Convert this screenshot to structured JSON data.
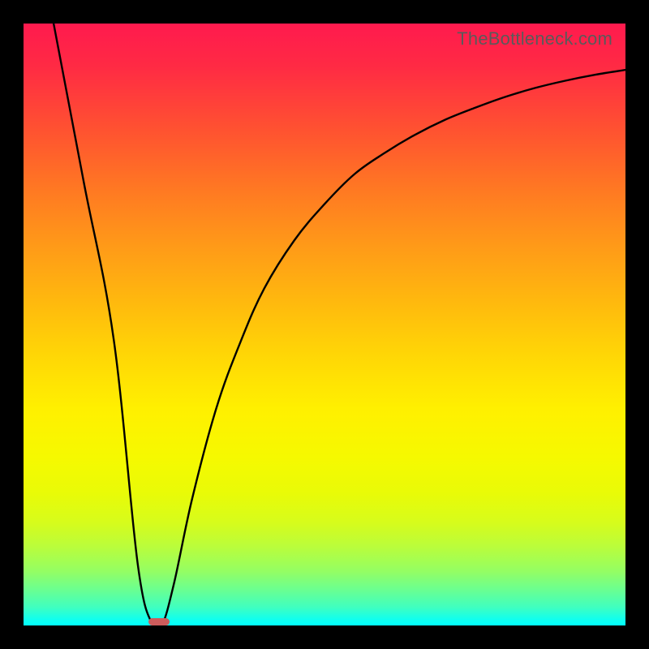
{
  "watermark_text": "TheBottleneck.com",
  "chart_data": {
    "type": "line",
    "title": "",
    "xlabel": "",
    "ylabel": "",
    "xlim": [
      0,
      100
    ],
    "ylim": [
      0,
      100
    ],
    "grid": false,
    "series": [
      {
        "name": "curve",
        "x": [
          5,
          10,
          15,
          19,
          21.5,
          23,
          25,
          28,
          32,
          36,
          40,
          45,
          50,
          55,
          60,
          65,
          70,
          75,
          80,
          85,
          90,
          95,
          100
        ],
        "y": [
          100,
          73.7,
          47.4,
          10,
          0,
          0,
          7,
          21,
          36,
          47,
          56,
          64,
          70,
          75,
          78.5,
          81.5,
          84,
          86,
          87.8,
          89.3,
          90.5,
          91.5,
          92.3
        ]
      }
    ],
    "marker": {
      "x_center": 22.5,
      "y": 0.6,
      "width_pct": 3.6,
      "height_pct": 1.3,
      "color": "#cd5c5c"
    },
    "gradient_stops": [
      {
        "pos": 0.0,
        "color": "#ff1a4e"
      },
      {
        "pos": 0.5,
        "color": "#ffd000"
      },
      {
        "pos": 0.78,
        "color": "#fff000"
      },
      {
        "pos": 1.0,
        "color": "#02fffc"
      }
    ]
  }
}
